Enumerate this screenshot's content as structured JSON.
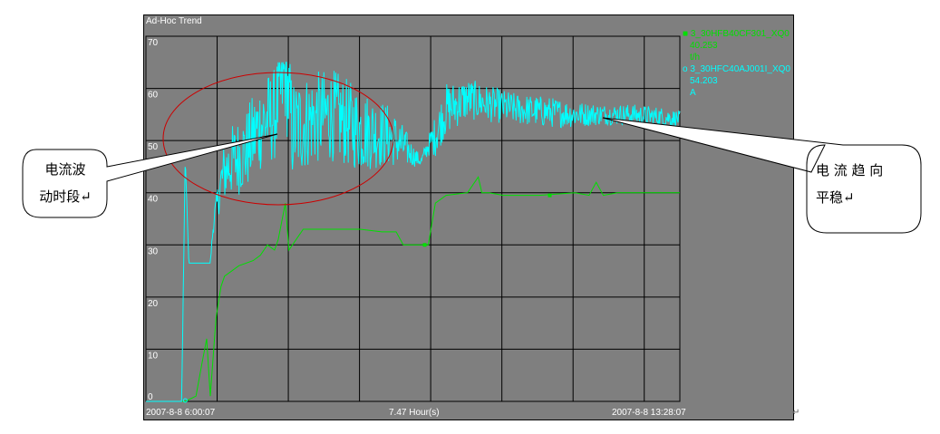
{
  "window": {
    "title": "Ad-Hoc Trend"
  },
  "chart_data": {
    "type": "line",
    "ylim": [
      0,
      70
    ],
    "y_ticks": [
      "70",
      "60",
      "50",
      "40",
      "30",
      "20",
      "10",
      "0"
    ],
    "x_start_label": "2007-8-8 6:00:07",
    "x_span_label": "7.47 Hour(s)",
    "x_end_label": "2007-8-8 13:28:07",
    "grid": true,
    "legend_position": "top-right",
    "series": [
      {
        "name": "3_30HFB40CF301_XQ0",
        "current_value": "40.253",
        "unit": "t/h",
        "color": "#00e000",
        "x_hours": [
          0,
          0.3,
          0.5,
          0.55,
          0.7,
          0.78,
          0.85,
          0.9,
          0.98,
          1.05,
          1.1,
          1.3,
          1.5,
          1.6,
          1.7,
          1.8,
          1.85,
          1.95,
          2.0,
          2.2,
          2.5,
          3.0,
          3.3,
          3.5,
          3.6,
          3.85,
          3.95,
          4.05,
          4.2,
          4.5,
          4.65,
          4.7,
          4.8,
          5.0,
          5.5,
          6.0,
          6.2,
          6.3,
          6.4,
          6.6,
          7.0,
          7.47
        ],
        "values": [
          0,
          0,
          0,
          0,
          1,
          7,
          12,
          1,
          16,
          22,
          24,
          26,
          27,
          28,
          30,
          29,
          31,
          38,
          29,
          33,
          33,
          33,
          32.5,
          32.5,
          30,
          30,
          30,
          38,
          39.5,
          40,
          43,
          40,
          40,
          39.5,
          39.5,
          40,
          39.5,
          42,
          39.5,
          40,
          40,
          40
        ]
      },
      {
        "name": "3_30HFC40AJ001I_XQ0",
        "current_value": "54.203",
        "unit": "A",
        "color": "#00ffff",
        "x_hours": [
          0,
          0.3,
          0.5,
          0.55,
          0.6,
          0.9,
          0.95,
          1.0,
          1.05,
          1.1,
          1.2,
          1.4,
          1.6,
          1.8,
          1.95,
          2.05,
          2.3,
          2.6,
          3.0,
          3.4,
          3.6,
          3.75,
          3.85,
          3.95,
          4.05,
          4.2,
          4.5,
          4.8,
          5.2,
          5.6,
          6.0,
          6.4,
          6.8,
          7.2,
          7.47
        ],
        "values": [
          0,
          0,
          0,
          47,
          26.5,
          26.5,
          35,
          38,
          42,
          44,
          46,
          48,
          53,
          55,
          63,
          52,
          54,
          55,
          52,
          51,
          49,
          47,
          46,
          49,
          51,
          56,
          58,
          57,
          56,
          55.5,
          55,
          55,
          55,
          54.5,
          54.2
        ],
        "noise_amplitude": [
          0,
          0,
          0,
          0,
          0,
          0,
          2,
          3,
          5,
          6,
          7,
          8,
          9,
          9,
          10,
          10,
          9,
          9,
          8,
          6,
          4,
          2,
          1,
          2,
          4,
          5,
          4,
          3.5,
          3,
          3,
          2.5,
          2,
          2,
          2,
          1.5
        ]
      }
    ]
  },
  "annotations": {
    "left_callout_lines": [
      "电流波",
      "动时段↵"
    ],
    "right_callout_lines": [
      "电 流 趋 向",
      "平稳↵"
    ],
    "edge_mark": "↵"
  },
  "colors": {
    "plot_bg": "#7f7f7f",
    "grid": "#000000",
    "ellipse": "#cc0000"
  }
}
